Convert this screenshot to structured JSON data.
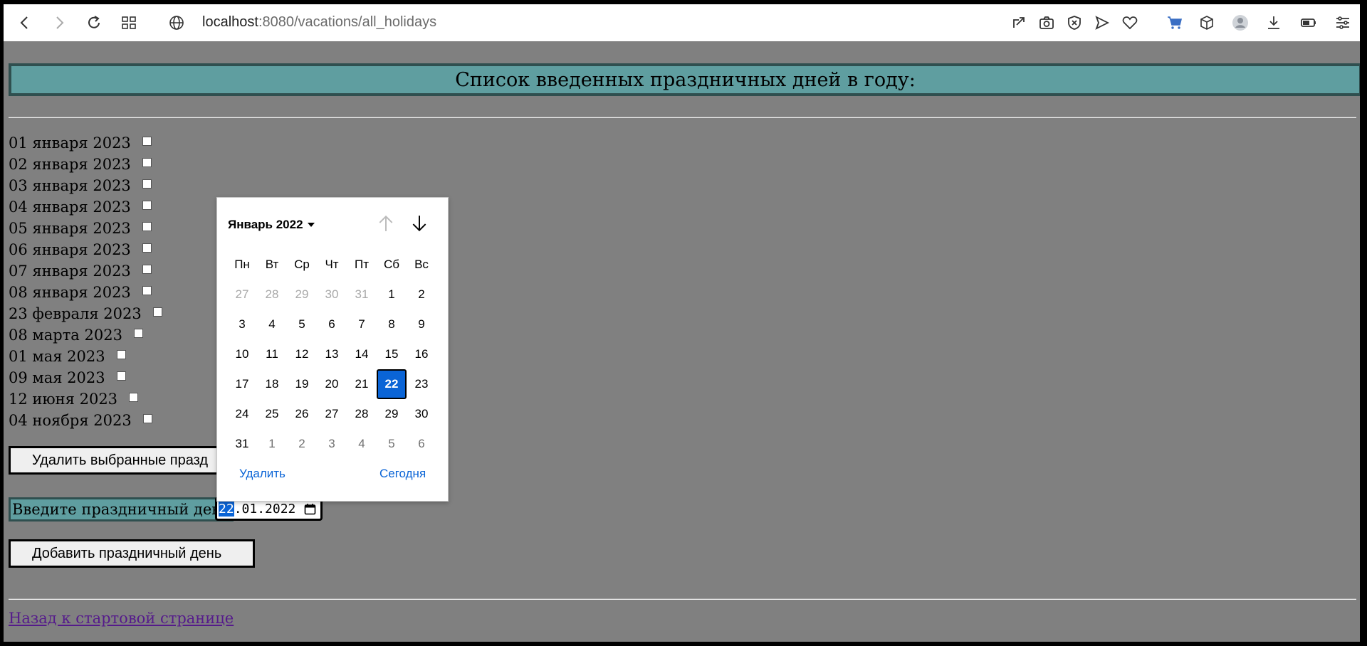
{
  "browser": {
    "url_host": "localhost",
    "url_path": ":8080/vacations/all_holidays"
  },
  "page": {
    "title": "Список введенных праздничных дней в году:",
    "holidays": [
      "01 января 2023",
      "02 января 2023",
      "03 января 2023",
      "04 января 2023",
      "05 января 2023",
      "06 января 2023",
      "07 января 2023",
      "08 января 2023",
      "23 февраля 2023",
      "08 марта 2023",
      "01 мая 2023",
      "09 мая 2023",
      "12 июня 2023",
      "04 ноября 2023"
    ],
    "delete_button": "Удалить выбранные празд",
    "date_label": "Введите праздничный день",
    "date_value": {
      "day": "22",
      "rest": ".01.2022"
    },
    "add_button": "Добавить праздничный день",
    "back_link": "Назад к стартовой странице"
  },
  "datepicker": {
    "month_label": "Январь 2022",
    "weekdays": [
      "Пн",
      "Вт",
      "Ср",
      "Чт",
      "Пт",
      "Сб",
      "Вс"
    ],
    "weeks": [
      [
        "27",
        "28",
        "29",
        "30",
        "31",
        "1",
        "2"
      ],
      [
        "3",
        "4",
        "5",
        "6",
        "7",
        "8",
        "9"
      ],
      [
        "10",
        "11",
        "12",
        "13",
        "14",
        "15",
        "16"
      ],
      [
        "17",
        "18",
        "19",
        "20",
        "21",
        "22",
        "23"
      ],
      [
        "24",
        "25",
        "26",
        "27",
        "28",
        "29",
        "30"
      ],
      [
        "31",
        "1",
        "2",
        "3",
        "4",
        "5",
        "6"
      ]
    ],
    "selected_day": "22",
    "clear_label": "Удалить",
    "today_label": "Сегодня"
  }
}
